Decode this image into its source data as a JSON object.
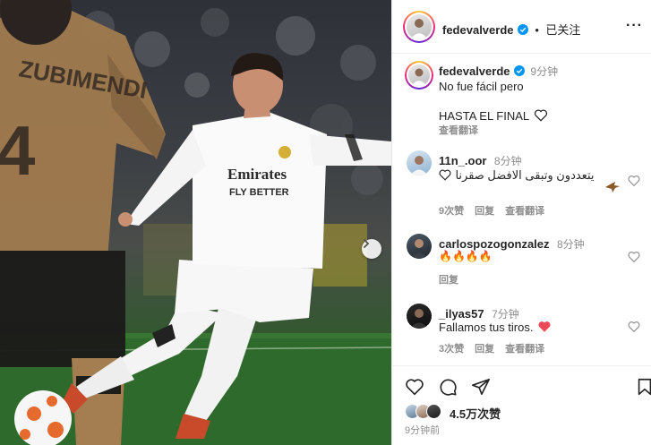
{
  "post": {
    "author": "fedevalverde",
    "follow_label": "已关注",
    "more_label": "···"
  },
  "caption": {
    "author": "fedevalverde",
    "time": "9分钟",
    "line1": "No fue fácil pero",
    "line2": "HASTA EL FINAL",
    "translate": "查看翻译"
  },
  "comments": [
    {
      "user": "11n_.oor",
      "time": "8分钟",
      "text": "يتعددون وتبقى الافضل صقرنا",
      "likes": "9次赞",
      "reply": "回复",
      "translate": "查看翻译"
    },
    {
      "user": "carlospozogonzalez",
      "time": "8分钟",
      "text": "🔥🔥🔥🔥",
      "reply": "回复"
    },
    {
      "user": "_ilyas57",
      "time": "7分钟",
      "text": "Fallamos tus tiros.",
      "likes": "3次赞",
      "reply": "回复",
      "translate": "查看翻译"
    }
  ],
  "footer": {
    "likes": "4.5万次赞",
    "time": "9分钟前"
  },
  "photo": {
    "shirt_sponsor_1": "Emirates",
    "shirt_sponsor_2": "FLY BETTER",
    "opponent_name": "ZUBIMENDI",
    "opponent_number": "4"
  },
  "colors": {
    "verified": "#0095f6",
    "heart_red": "#ed4956",
    "text": "#262626",
    "muted": "#8e8e8e"
  }
}
